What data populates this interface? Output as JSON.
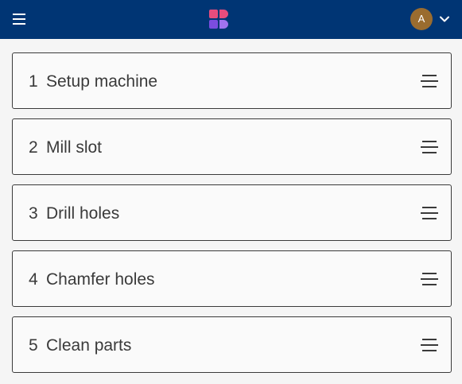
{
  "header": {
    "menu_icon": "hamburger-menu-icon",
    "logo_icon": "app-logo-icon",
    "avatar_initial": "A",
    "account_menu_icon": "chevron-down-icon",
    "colors": {
      "bar": "#003574",
      "avatar": "#9a6c2f",
      "logo_pink": "#e84d7d",
      "logo_purple": "#7b4de0",
      "logo_violet": "#a173f0"
    }
  },
  "steps": [
    {
      "number": "1",
      "label": "Setup machine",
      "handle_icon": "drag-handle-icon"
    },
    {
      "number": "2",
      "label": "Mill slot",
      "handle_icon": "drag-handle-icon"
    },
    {
      "number": "3",
      "label": "Drill holes",
      "handle_icon": "drag-handle-icon"
    },
    {
      "number": "4",
      "label": "Chamfer holes",
      "handle_icon": "drag-handle-icon"
    },
    {
      "number": "5",
      "label": "Clean parts",
      "handle_icon": "drag-handle-icon"
    }
  ]
}
